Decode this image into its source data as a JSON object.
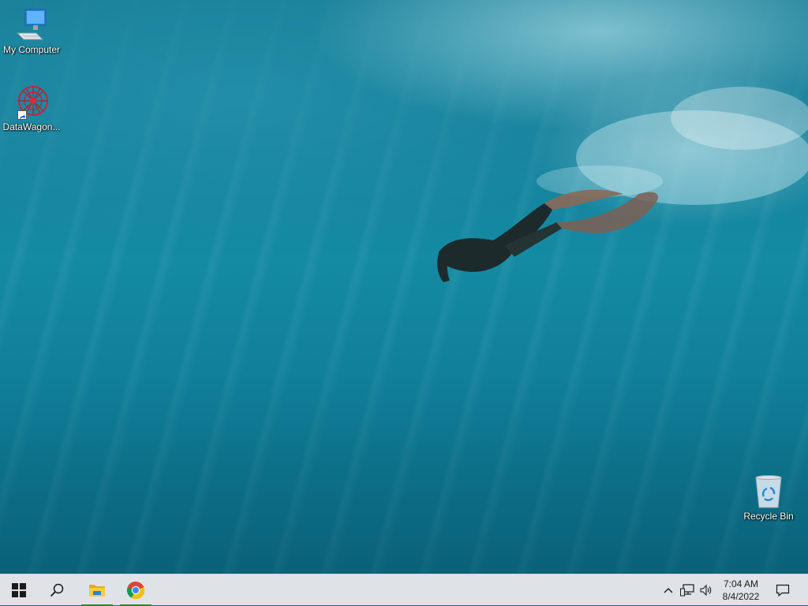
{
  "desktop": {
    "icons": [
      {
        "label": "My Computer",
        "icon": "computer-icon"
      },
      {
        "label": "DataWagon...",
        "icon": "datawagon-icon"
      },
      {
        "label": "Recycle Bin",
        "icon": "recycle-bin-icon"
      }
    ],
    "wallpaper": "underwater-freediver"
  },
  "taskbar": {
    "start": {
      "icon": "windows-start-icon"
    },
    "search": {
      "icon": "search-icon"
    },
    "apps": [
      {
        "name": "File Explorer",
        "icon": "file-explorer-icon",
        "running": true
      },
      {
        "name": "Google Chrome",
        "icon": "chrome-icon",
        "running": true
      }
    ],
    "tray": {
      "chevron": "chevron-up-icon",
      "network": "network-icon",
      "volume": "volume-icon",
      "notifications": "notification-icon"
    },
    "clock": {
      "time": "7:04 AM",
      "date": "8/4/2022"
    }
  },
  "colors": {
    "taskbar_bg": "#dfe3e8",
    "running_indicator": "#1f8c2b",
    "wallpaper_water": "#148aa3"
  }
}
